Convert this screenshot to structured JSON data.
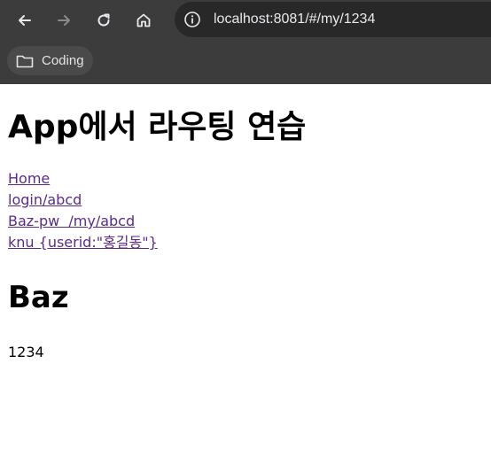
{
  "browser": {
    "url": "localhost:8081/#/my/1234",
    "bookmark_label": "Coding",
    "icons": [
      "back-arrow-icon",
      "forward-arrow-icon",
      "reload-icon",
      "home-icon",
      "info-icon",
      "folder-icon"
    ]
  },
  "page": {
    "title": "App에서 라우팅 연습",
    "links": [
      "Home",
      "login/abcd",
      "Baz-pw  /my/abcd",
      "knu {userid:\"홍길동\"}"
    ],
    "section_heading": "Baz",
    "param_value": "1234"
  },
  "colors": {
    "chrome_bg": "#3c3c3c",
    "omnibox_bg": "#282828",
    "link": "#5b2b86"
  }
}
